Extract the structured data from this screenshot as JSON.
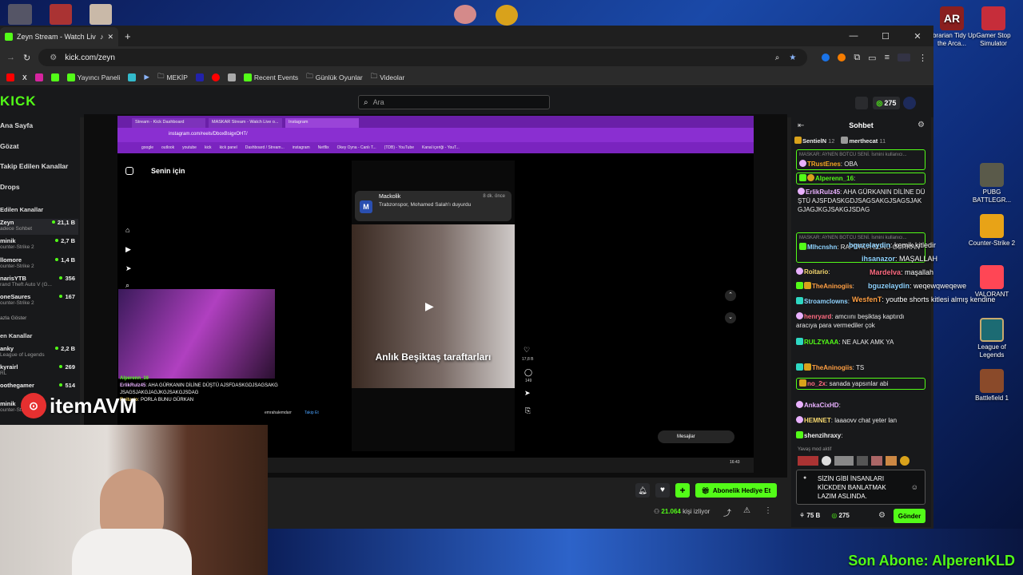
{
  "desktop": {
    "icons": [
      {
        "label": "Librarian Tidy Up the Arca..."
      },
      {
        "label": "Gamer Stop Simulator"
      },
      {
        "label": "PUBG BATTLEGR..."
      },
      {
        "label": "Counter-Strike 2"
      },
      {
        "label": "VALORANT"
      },
      {
        "label": "League of Legends"
      },
      {
        "label": "Battlefield 1"
      }
    ],
    "overlay_brand": "itemAVM",
    "son_abone": "Son Abone: AlperenKLD"
  },
  "browser": {
    "tab_title": "Zeyn Stream - Watch Live o",
    "url": "kick.com/zeyn",
    "bookmarks": [
      "Yayıncı Paneli",
      "MEKİP",
      "Recent Events",
      "Günlük Oyunlar",
      "Videolar"
    ]
  },
  "kick": {
    "logo": "KICK",
    "search_placeholder": "Ara",
    "coins": "275",
    "nav": [
      "Ana Sayfa",
      "Gözat",
      "Takip Edilen Kanallar",
      "Drops"
    ],
    "followed_heading": "Edilen Kanallar",
    "followed": [
      {
        "name": "Zeyn",
        "game": "adece Sohbet",
        "viewers": "21,1 B"
      },
      {
        "name": "minik",
        "game": "ounter-Strike 2",
        "viewers": "2,7 B"
      },
      {
        "name": "llomore",
        "game": "ounter-Strike 2",
        "viewers": "1,4 B"
      },
      {
        "name": "narisYTB",
        "game": "rand Theft Auto V (G...",
        "viewers": "356"
      },
      {
        "name": "oneSaures",
        "game": "ounter-Strike 2",
        "viewers": "167"
      }
    ],
    "more_label": "azla Göster",
    "recommended_heading": "en Kanallar",
    "recommended": [
      {
        "name": "anky",
        "game": "League of Legends",
        "viewers": "2,2 B"
      },
      {
        "name": "kyrairl",
        "game": "RL",
        "viewers": "269"
      },
      {
        "name": "oothegamer",
        "game": "",
        "viewers": "514"
      },
      {
        "name": "minik",
        "game": "ounter-Strike",
        "viewers": ""
      }
    ]
  },
  "inner": {
    "tabs": [
      "Stream - Kick Dashboard",
      "MASKAR Stream - Watch Live o...",
      "Instagram"
    ],
    "url": "instagram.com/reels/DboxBsigxOHT/",
    "bookmarks": [
      "google",
      "outlook",
      "youtube",
      "kick",
      "kick panel",
      "Dashboard / Stream...",
      "instagram",
      "Netflix",
      "Okey Oyna - Canlı T...",
      "(TDB) - YouTube",
      "Kanal içeriği - YouT..."
    ],
    "feed_title": "Senin için",
    "notif_app": "Mackolik",
    "notif_time": "8 dk. önce",
    "notif_text": "Trabzonspor, Mohamed Salah'ı duyurdu",
    "reel_caption": "Anlık Beşiktaş taraftarları",
    "like_count": "17,8 B",
    "comment_count": "149",
    "messages_label": "Mesajlar",
    "commenter": "emrahalemdarr",
    "follow_label": "Takip Et",
    "clock": "16:43"
  },
  "pip_chat": [
    {
      "user": "Alperenn_16",
      "text": ""
    },
    {
      "user": "ErlikRulz45",
      "text": "AHA GÜRKANIN DİLİNE DÜŞTÜ AJSFDASKGDJSAGSAKGJSAGSJAKGJAGJKGJSAKGJSDAG"
    },
    {
      "user": "Roitario",
      "text": "PORLA BUNU GÜRKAN"
    }
  ],
  "player": {
    "viewers": "21.064",
    "viewers_suffix": "kişi izliyor",
    "gift_sub": "Abonelik Hediye Et"
  },
  "chat": {
    "title": "Sohbet",
    "pinned": [
      {
        "user": "SentielN",
        "badge": "12"
      },
      {
        "user": "merthecat",
        "badge": "11"
      }
    ],
    "messages": [
      {
        "user": "TRustEnes",
        "text": "OBA",
        "color": "#f5a623",
        "mod_note": "MASKAR: AYNEN BOTCU SENİ. İsmini kullanıcı..."
      },
      {
        "user": "Alperenn_16",
        "text": "",
        "color": "#53fc18"
      },
      {
        "user": "ErlikRulz45",
        "text": "AHA GÜRKANIN DİLİNE DÜŞTÜ AJSFDASKGDJSAGSAKGJSAGSJAKGJAGJKGJSAKGJSDAG",
        "color": "#e9b1ff"
      },
      {
        "user": "Mlhcnshn",
        "text": "RAPORLA BUNU GÜRKAN",
        "color": "#8fd3ff",
        "mod_note": "MASKAR: AYNEN BOTCU SENİ. İsmini kullanıcı..."
      },
      {
        "user": "Roitario",
        "text": "",
        "color": "#f5d76e"
      },
      {
        "user": "TheAninogiis",
        "text": "",
        "color": "#ff9f43"
      },
      {
        "user": "Stroamclowns",
        "text": "",
        "color": "#8fd3ff"
      },
      {
        "user": "henryard",
        "text": "amcıını beşiktaş kaptırdı aracıya para vermediler çok",
        "color": "#ff6b81"
      },
      {
        "user": "RULZYAAA",
        "text": "NE ALAK AMK YA",
        "color": "#53fc18"
      },
      {
        "user": "TheAninogiis",
        "text": "TS",
        "color": "#ff9f43"
      },
      {
        "user": "no_2x",
        "text": "sanada yapsınlar abi",
        "color": "#ff6b81"
      },
      {
        "user": "AnkaCixHD",
        "text": "",
        "color": "#e9b1ff"
      },
      {
        "user": "HEMNET",
        "text": "laaaovv chat yeter lan",
        "color": "#f5d76e"
      },
      {
        "user": "shenzihraxy",
        "text": "",
        "color": "#eee"
      }
    ],
    "overflow_messages": [
      {
        "user": "bguzelaydin",
        "text": "kemik kitledir"
      },
      {
        "user": "ihsanazor",
        "text": "MAŞALLAH"
      },
      {
        "user": "Mardelva",
        "text": "maşallah"
      },
      {
        "user": "bguzelaydin",
        "text": "weqewqweqewe"
      },
      {
        "user": "WesfenT",
        "text": "youtbe shorts kitlesi almış kendine"
      }
    ],
    "slow_mode": "Yavaş mod aktif",
    "input_text": "SİZİN GİBİ İNSANLARI KİCKDEN BANLATMAK LAZIM ASLINDA.",
    "coins_75": "75 B",
    "coins_275": "275",
    "send": "Gönder"
  }
}
